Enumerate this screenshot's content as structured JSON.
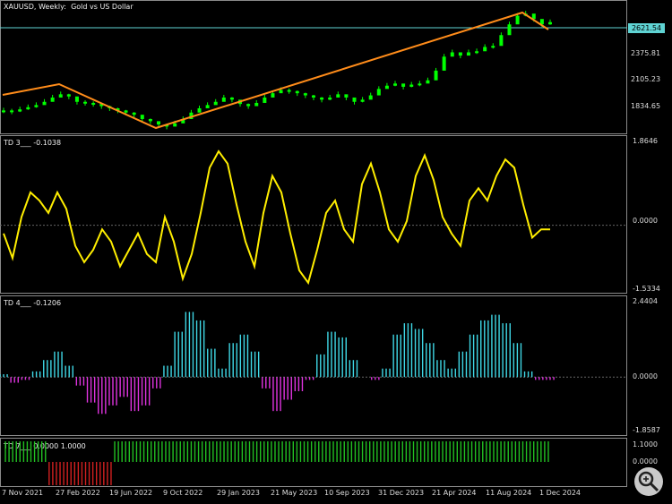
{
  "chart_title": "XAUUSD, Weekly:  Gold vs US Dollar",
  "price_pane": {
    "y_ticks": [
      "2621.54",
      "2375.81",
      "2105.23",
      "1834.65"
    ],
    "current_price_label": "2621.54",
    "hline_color": "#5fd3d3",
    "candle_color": "#00ff00",
    "trendline_color": "#ff8c1a",
    "ylim": [
      1620,
      2760
    ]
  },
  "td3": {
    "label": "TD 3___ -0.1038",
    "y_ticks": [
      "1.8646",
      "0.0000",
      "-1.5334"
    ],
    "line_color": "#ffee00",
    "ylim": [
      -1.5334,
      1.8646
    ]
  },
  "td4": {
    "label": "TD 4___ -0.1206",
    "y_ticks": [
      "2.4404",
      "0.0000",
      "-1.8587"
    ],
    "pos_color": "#3fd8e6",
    "neg_color": "#e033e0",
    "ylim": [
      -1.8587,
      2.4404
    ]
  },
  "td7": {
    "label": "TD 7___ 0.0000 1.0000",
    "y_ticks": [
      "1.1000",
      "0.0000"
    ],
    "up_color": "#22c022",
    "down_color": "#d22020"
  },
  "date_axis": [
    "7 Nov 2021",
    "27 Feb 2022",
    "19 Jun 2022",
    "9 Oct 2022",
    "29 Jan 2023",
    "21 May 2023",
    "10 Sep 2023",
    "31 Dec 2023",
    "21 Apr 2024",
    "11 Aug 2024",
    "1 Dec 2024"
  ],
  "chart_data": [
    {
      "type": "line",
      "title": "XAUUSD, Weekly:  Gold vs US Dollar",
      "series": [
        {
          "values": [
            1800,
            1790,
            1810,
            1830,
            1850,
            1880,
            1920,
            1950,
            1930,
            1880,
            1870,
            1860,
            1840,
            1820,
            1800,
            1780,
            1760,
            1720,
            1700,
            1670,
            1650,
            1680,
            1720,
            1780,
            1820,
            1850,
            1880,
            1920,
            1900,
            1860,
            1840,
            1870,
            1920,
            1960,
            1990,
            1980,
            1960,
            1940,
            1920,
            1900,
            1920,
            1950,
            1920,
            1880,
            1900,
            1940,
            2000,
            2030,
            2050,
            2020,
            2040,
            2050,
            2080,
            2170,
            2300,
            2340,
            2310,
            2340,
            2350,
            2390,
            2400,
            2500,
            2600,
            2680,
            2700,
            2650,
            2600,
            2621
          ]
        }
      ]
    },
    {
      "type": "line",
      "title": "TD 3___ -0.1038",
      "series": [
        {
          "values": [
            -0.2,
            -0.8,
            0.2,
            0.8,
            0.6,
            0.3,
            0.8,
            0.4,
            -0.5,
            -0.9,
            -0.6,
            -0.1,
            -0.4,
            -1.0,
            -0.6,
            -0.2,
            -0.7,
            -0.9,
            0.2,
            -0.4,
            -1.3,
            -0.7,
            0.3,
            1.4,
            1.8,
            1.5,
            0.5,
            -0.4,
            -1.0,
            0.3,
            1.2,
            0.8,
            -0.2,
            -1.1,
            -1.4,
            -0.6,
            0.3,
            0.6,
            -0.1,
            -0.4,
            1.0,
            1.5,
            0.8,
            -0.1,
            -0.4,
            0.1,
            1.2,
            1.7,
            1.1,
            0.2,
            -0.2,
            -0.5,
            0.6,
            0.9,
            0.6,
            1.2,
            1.6,
            1.4,
            0.5,
            -0.3,
            -0.1,
            -0.1
          ]
        }
      ]
    },
    {
      "type": "bar",
      "title": "TD 4___ -0.1206",
      "series": [
        {
          "values": [
            0.1,
            -0.2,
            -0.1,
            0.2,
            0.6,
            0.9,
            0.4,
            -0.3,
            -0.9,
            -1.3,
            -1.0,
            -0.7,
            -1.2,
            -1.0,
            -0.4,
            0.4,
            1.6,
            2.3,
            2.0,
            1.0,
            0.3,
            1.2,
            1.5,
            0.9,
            -0.4,
            -1.2,
            -0.8,
            -0.5,
            -0.1,
            0.8,
            1.6,
            1.4,
            0.6,
            0.0,
            -0.1,
            0.3,
            1.5,
            1.9,
            1.7,
            1.2,
            0.6,
            0.3,
            0.9,
            1.5,
            2.0,
            2.2,
            1.9,
            1.2,
            0.2,
            -0.1,
            -0.1
          ]
        }
      ]
    },
    {
      "type": "bar",
      "title": "TD 7___ 0.0000 1.0000",
      "ylim": [
        0,
        1.1
      ],
      "series": [
        {
          "name": "0.0000",
          "values": [
            0,
            0,
            0,
            0,
            1,
            1,
            1,
            1,
            1,
            1,
            0,
            0,
            0,
            0,
            0,
            0,
            0,
            0,
            0,
            0,
            0,
            0,
            0,
            0,
            0,
            0,
            0,
            0,
            0,
            0,
            0,
            0,
            0,
            0,
            0,
            0,
            0,
            0,
            0,
            0,
            0,
            0,
            0,
            0,
            0,
            0,
            0,
            0,
            0,
            0
          ]
        },
        {
          "name": "1.0000",
          "values": [
            1,
            1,
            1,
            1,
            0,
            0,
            0,
            0,
            0,
            0,
            1,
            1,
            1,
            1,
            1,
            1,
            1,
            1,
            1,
            1,
            1,
            1,
            1,
            1,
            1,
            1,
            1,
            1,
            1,
            1,
            1,
            1,
            1,
            1,
            1,
            1,
            1,
            1,
            1,
            1,
            1,
            1,
            1,
            1,
            1,
            1,
            1,
            1,
            1,
            1
          ]
        }
      ]
    }
  ]
}
